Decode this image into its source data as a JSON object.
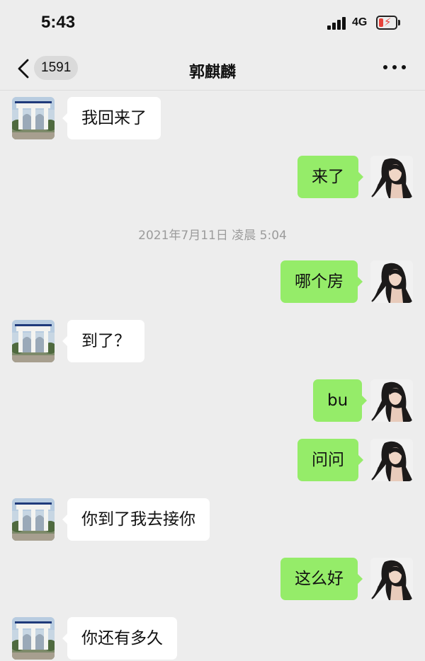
{
  "status_bar": {
    "time": "5:43",
    "network": "4G",
    "battery_level": 0.2,
    "battery_color": "#e8433b"
  },
  "nav": {
    "unread_count": "1591",
    "title": "郭麒麟",
    "back_icon": "chevron-left-icon",
    "more_icon": "more-dots-icon"
  },
  "colors": {
    "background": "#ededed",
    "sent_bubble": "#95ec69",
    "received_bubble": "#ffffff",
    "timestamp_text": "#9b9b9b"
  },
  "messages": [
    {
      "side": "left",
      "text": "我回来了"
    },
    {
      "side": "right",
      "text": "来了"
    },
    {
      "type": "timestamp",
      "text": "2021年7月11日 凌晨 5:04"
    },
    {
      "side": "right",
      "text": "哪个房"
    },
    {
      "side": "left",
      "text": "到了？"
    },
    {
      "side": "right",
      "text": "bu"
    },
    {
      "side": "right",
      "text": "问问"
    },
    {
      "side": "left",
      "text": "你到了我去接你"
    },
    {
      "side": "right",
      "text": "这么好"
    },
    {
      "side": "left",
      "text": "你还有多久"
    }
  ]
}
